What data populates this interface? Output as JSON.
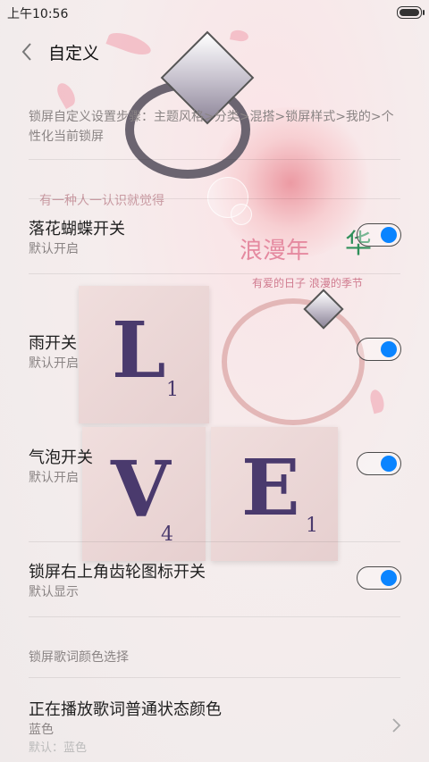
{
  "status_bar": {
    "time": "上午10:56"
  },
  "header": {
    "title": "自定义"
  },
  "description": "锁屏自定义设置步骤：主题风格>分类>混搭>锁屏样式>我的>个性化当前锁屏",
  "settings": [
    {
      "label": "落花蝴蝶开关",
      "sublabel": "默认开启",
      "enabled": true
    },
    {
      "label": "雨开关",
      "sublabel": "默认开启",
      "enabled": true
    },
    {
      "label": "气泡开关",
      "sublabel": "默认开启",
      "enabled": true
    },
    {
      "label": "锁屏右上角齿轮图标开关",
      "sublabel": "默认显示",
      "enabled": true
    }
  ],
  "lyrics_section": {
    "header": "锁屏歌词颜色选择",
    "item": {
      "label": "正在播放歌词普通状态颜色",
      "value": "蓝色",
      "truncated_text": "默认：蓝色"
    }
  },
  "wallpaper": {
    "tagline": "有一种人一认识就觉得",
    "romance_text": "浪漫年",
    "romance_hua": "华",
    "small_line": "有爱的日子 浪漫的季节",
    "letters": [
      "L",
      "O",
      "V",
      "E"
    ],
    "subscripts": [
      "1",
      "4",
      "1"
    ]
  },
  "colors": {
    "accent": "#0a84ff",
    "text": "#1f1f1f",
    "secondary": "#8a8484"
  }
}
